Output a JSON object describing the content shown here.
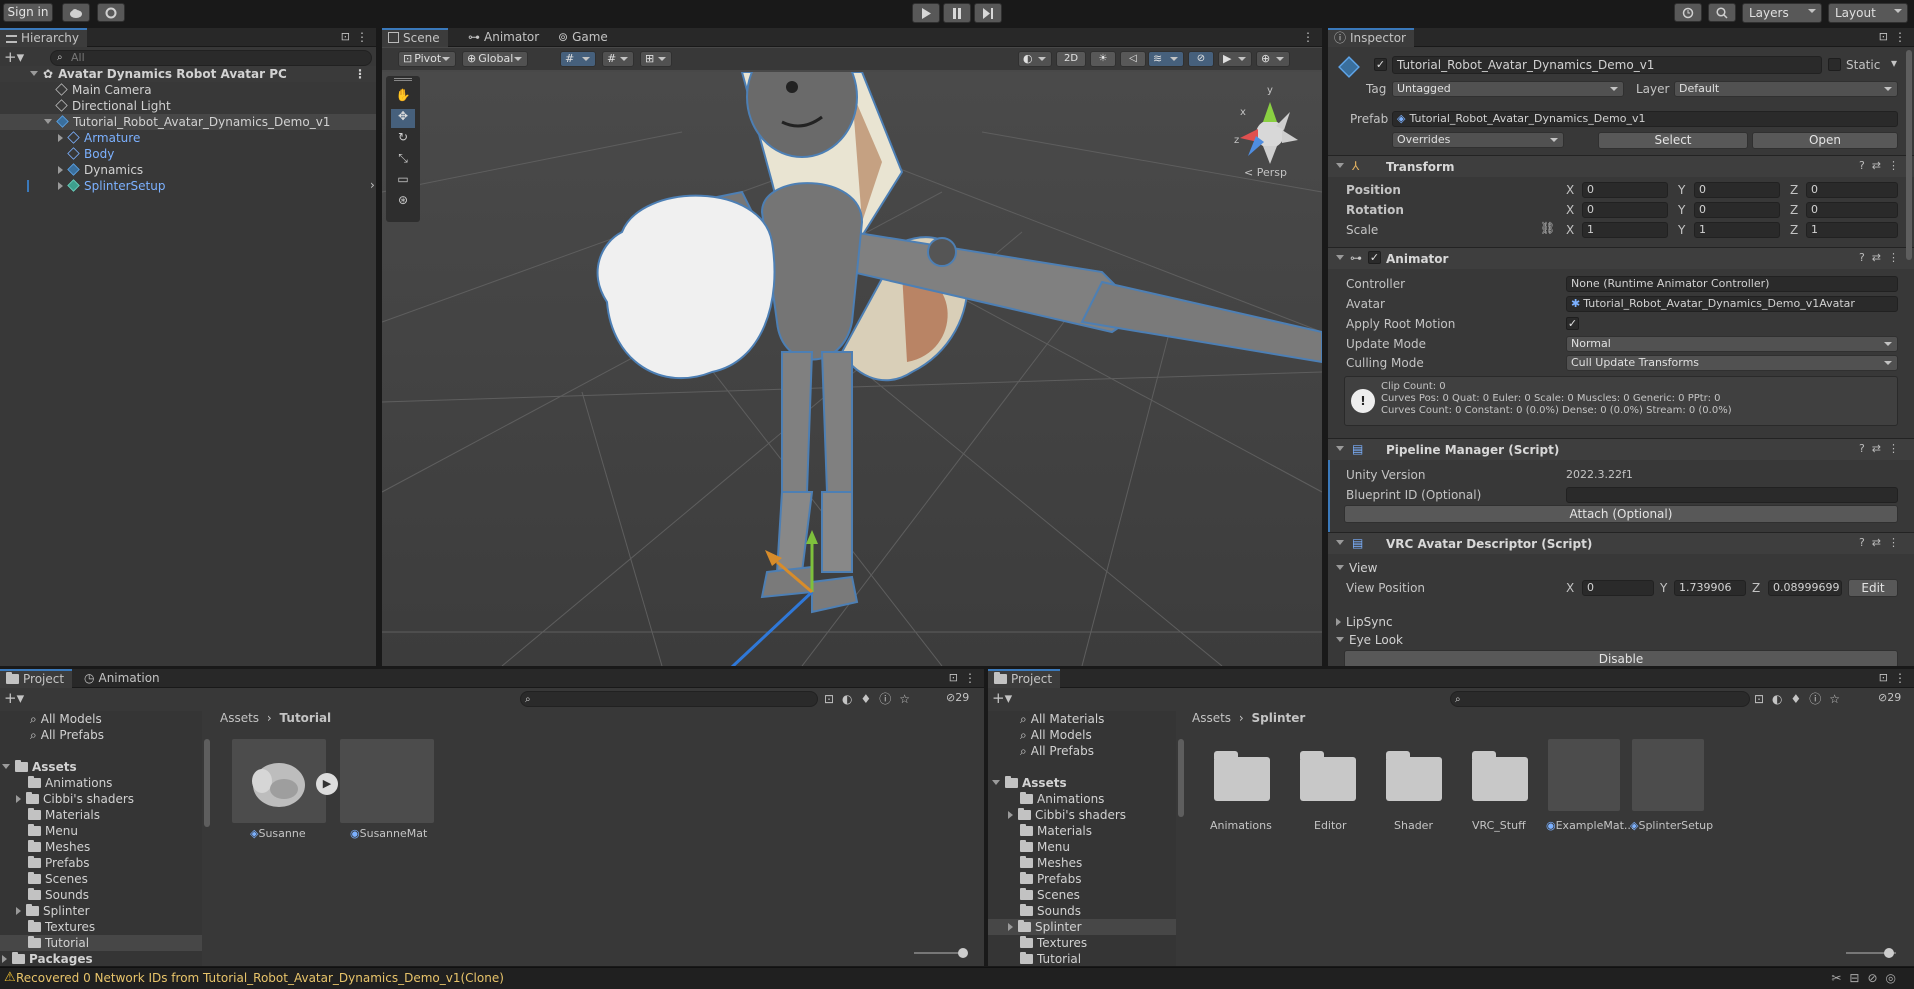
{
  "toolbar": {
    "sign_in": "Sign in",
    "layers": "Layers",
    "layout": "Layout"
  },
  "hierarchy": {
    "tab": "Hierarchy",
    "search_placeholder": "All",
    "items": [
      {
        "label": "Avatar Dynamics Robot Avatar PC"
      },
      {
        "label": "Main Camera"
      },
      {
        "label": "Directional Light"
      },
      {
        "label": "Tutorial_Robot_Avatar_Dynamics_Demo_v1"
      },
      {
        "label": "Armature"
      },
      {
        "label": "Body"
      },
      {
        "label": "Dynamics"
      },
      {
        "label": "SplinterSetup"
      }
    ]
  },
  "scene": {
    "tabs": [
      "Scene",
      "Animator",
      "Game"
    ],
    "pivot": "Pivot",
    "global": "Global",
    "mode2d": "2D",
    "persp": "< Persp",
    "axis_y": "y",
    "axis_x": "x",
    "axis_z": "z"
  },
  "inspector": {
    "tab": "Inspector",
    "object_name": "Tutorial_Robot_Avatar_Dynamics_Demo_v1",
    "static": "Static",
    "tag_label": "Tag",
    "tag": "Untagged",
    "layer_label": "Layer",
    "layer": "Default",
    "prefab_label": "Prefab",
    "prefab": "Tutorial_Robot_Avatar_Dynamics_Demo_v1",
    "overrides": "Overrides",
    "select": "Select",
    "open": "Open",
    "transform": {
      "title": "Transform",
      "position": "Position",
      "rotation": "Rotation",
      "scale": "Scale",
      "x": "X",
      "y": "Y",
      "z": "Z",
      "pos": [
        "0",
        "0",
        "0"
      ],
      "rot": [
        "0",
        "0",
        "0"
      ],
      "scl": [
        "1",
        "1",
        "1"
      ]
    },
    "animator": {
      "title": "Animator",
      "controller_label": "Controller",
      "controller": "None (Runtime Animator Controller)",
      "avatar_label": "Avatar",
      "avatar": "Tutorial_Robot_Avatar_Dynamics_Demo_v1Avatar",
      "apply_root": "Apply Root Motion",
      "update_label": "Update Mode",
      "update": "Normal",
      "culling_label": "Culling Mode",
      "culling": "Cull Update Transforms",
      "info1": "Clip Count: 0",
      "info2": "Curves Pos: 0 Quat: 0 Euler: 0 Scale: 0 Muscles: 0 Generic: 0 PPtr: 0",
      "info3": "Curves Count: 0 Constant: 0 (0.0%) Dense: 0 (0.0%) Stream: 0 (0.0%)"
    },
    "pipeline": {
      "title": "Pipeline Manager (Script)",
      "unity_label": "Unity Version",
      "unity": "2022.3.22f1",
      "blueprint_label": "Blueprint ID (Optional)",
      "attach": "Attach (Optional)"
    },
    "vrc": {
      "title": "VRC Avatar Descriptor (Script)",
      "view": "View",
      "view_pos": "View Position",
      "x": "0",
      "y": "1.739906",
      "z": "0.08999699",
      "edit": "Edit",
      "lipsync": "LipSync",
      "eyelook": "Eye Look",
      "disable": "Disable"
    }
  },
  "project_left": {
    "tabs": [
      "Project",
      "Animation"
    ],
    "count": "29",
    "favorites": [
      "All Models",
      "All Prefabs"
    ],
    "root": "Assets",
    "folders": [
      "Animations",
      "Cibbi's shaders",
      "Materials",
      "Menu",
      "Meshes",
      "Prefabs",
      "Scenes",
      "Sounds",
      "Splinter",
      "Textures",
      "Tutorial"
    ],
    "packages": "Packages",
    "crumb1": "Assets",
    "crumb2": "Tutorial",
    "assets": [
      "Susanne",
      "SusanneMat"
    ]
  },
  "project_right": {
    "tab": "Project",
    "count": "29",
    "favorites": [
      "All Materials",
      "All Models",
      "All Prefabs"
    ],
    "root": "Assets",
    "folders": [
      "Animations",
      "Cibbi's shaders",
      "Materials",
      "Menu",
      "Meshes",
      "Prefabs",
      "Scenes",
      "Sounds",
      "Splinter",
      "Textures",
      "Tutorial"
    ],
    "crumb1": "Assets",
    "crumb2": "Splinter",
    "assets": [
      "Animations",
      "Editor",
      "Shader",
      "VRC_Stuff",
      "ExampleMat...",
      "SplinterSetup"
    ]
  },
  "status": {
    "message": "Recovered 0 Network IDs from Tutorial_Robot_Avatar_Dynamics_Demo_v1(Clone)"
  }
}
